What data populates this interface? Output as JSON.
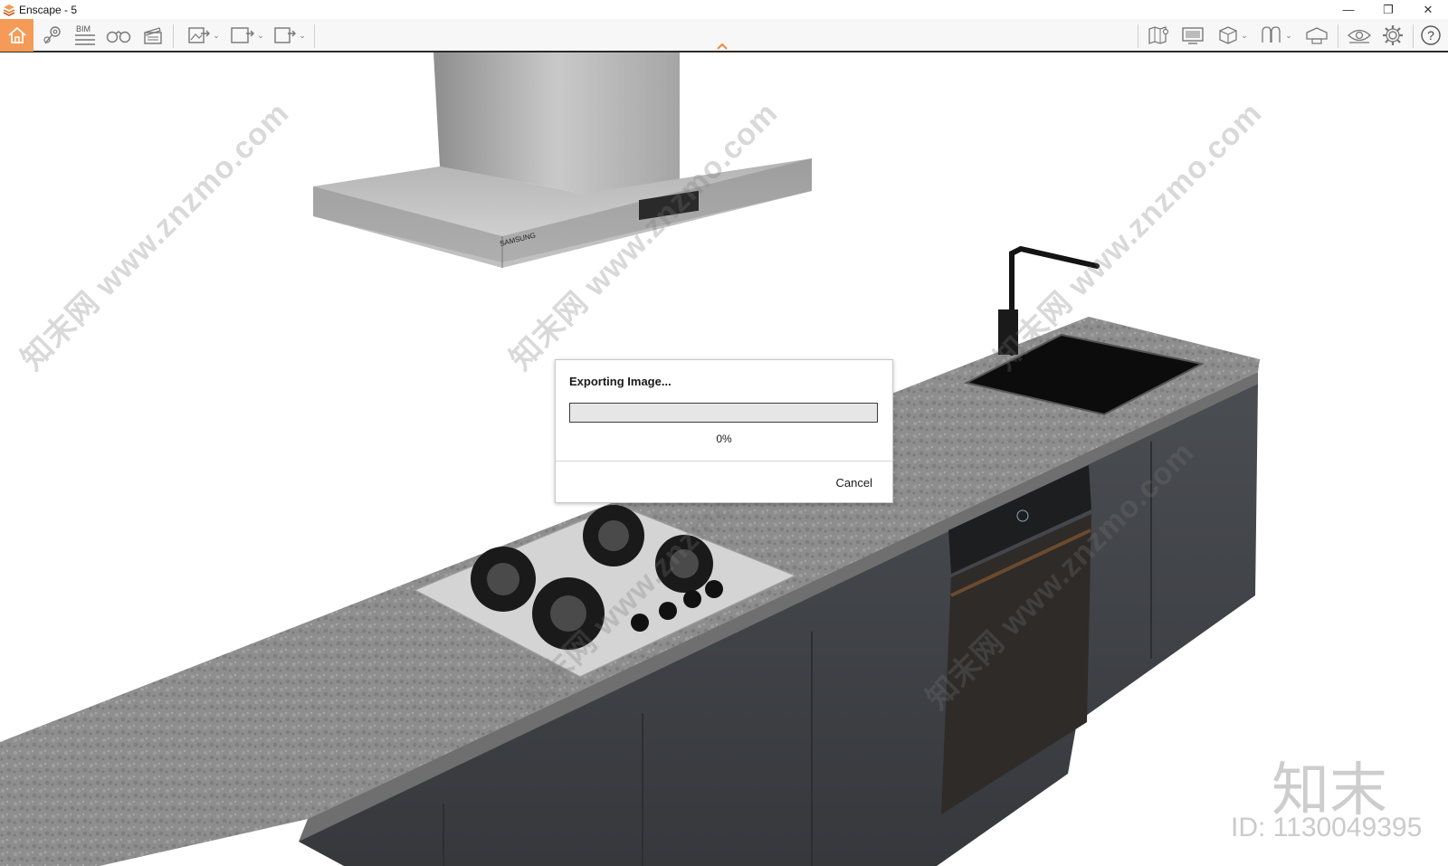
{
  "window": {
    "title": "Enscape - 5",
    "controls": {
      "minimize": "—",
      "restore": "❐",
      "close": "✕"
    }
  },
  "toolbar": {
    "home_icon": "home-icon",
    "left_group": [
      {
        "name": "views-icon",
        "has_menu": false
      },
      {
        "name": "bim-icon",
        "label": "BIM",
        "has_menu": false
      },
      {
        "name": "binoculars-icon",
        "has_menu": false
      },
      {
        "name": "clapperboard-icon",
        "has_menu": false
      }
    ],
    "export_group": [
      {
        "name": "export-image-icon",
        "has_menu": true
      },
      {
        "name": "export-panorama-icon",
        "label": "360°",
        "has_menu": true
      },
      {
        "name": "export-exe-icon",
        "label": "EXE",
        "has_menu": true
      }
    ],
    "right_group": [
      {
        "name": "map-icon",
        "has_menu": false
      },
      {
        "name": "monitor-icon",
        "has_menu": false
      },
      {
        "name": "cube-icon",
        "has_menu": true
      },
      {
        "name": "vr-icon",
        "has_menu": true
      },
      {
        "name": "headset-icon",
        "has_menu": false
      },
      {
        "name": "eye-icon",
        "has_menu": false
      },
      {
        "name": "gear-icon",
        "has_menu": false
      },
      {
        "name": "help-icon",
        "label": "?",
        "has_menu": false
      }
    ],
    "collapse_icon": "chevron-up-icon",
    "accent_color": "#f59b57"
  },
  "dialog": {
    "title": "Exporting Image...",
    "progress_percent": 0,
    "progress_text": "0%",
    "cancel_label": "Cancel"
  },
  "scene": {
    "hood_brand": "SAMSUNG"
  },
  "watermark": {
    "text": "知末网 www.znzmo.com",
    "logo": "知末",
    "id": "ID: 1130049395"
  }
}
